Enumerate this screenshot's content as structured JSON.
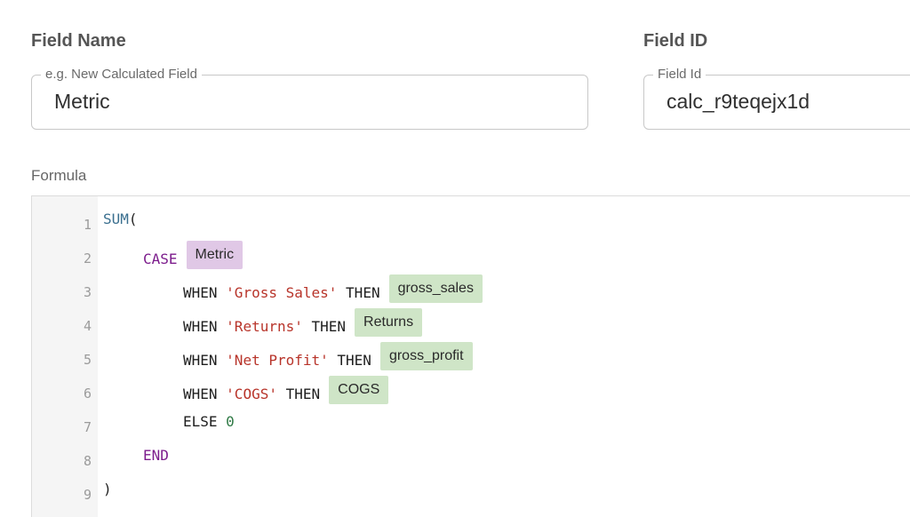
{
  "field_name": {
    "heading": "Field Name",
    "legend": "e.g. New Calculated Field",
    "value": "Metric"
  },
  "field_id": {
    "heading": "Field ID",
    "legend": "Field Id",
    "value": "calc_r9teqejx1d"
  },
  "formula": {
    "label": "Formula",
    "line_numbers": [
      "1",
      "2",
      "3",
      "4",
      "5",
      "6",
      "7",
      "8",
      "9"
    ],
    "line1": {
      "fn": "SUM",
      "paren": "("
    },
    "line2": {
      "kw": "CASE",
      "chip": "Metric"
    },
    "line3": {
      "when": "WHEN",
      "str": "'Gross Sales'",
      "then": "THEN",
      "chip": "gross_sales"
    },
    "line4": {
      "when": "WHEN",
      "str": "'Returns'",
      "then": "THEN",
      "chip": "Returns"
    },
    "line5": {
      "when": "WHEN",
      "str": "'Net Profit'",
      "then": "THEN",
      "chip": "gross_profit"
    },
    "line6": {
      "when": "WHEN",
      "str": "'COGS'",
      "then": "THEN",
      "chip": "COGS"
    },
    "line7": {
      "else": "ELSE",
      "num": "0"
    },
    "line8": {
      "kw": "END"
    },
    "line9": {
      "paren": ")"
    }
  },
  "colors": {
    "chip_field_ref": "#e0c8e6",
    "chip_column_ref": "#cfe5c7",
    "keyword_case": "#7c1c8c",
    "string": "#b8342a",
    "number": "#2f7a45",
    "function": "#3a6f8f"
  }
}
